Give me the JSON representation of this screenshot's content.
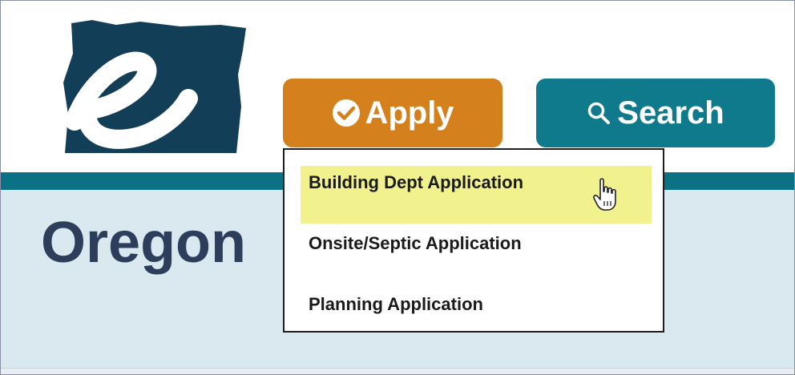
{
  "logo": {
    "icon": "eoregon-logo-icon",
    "brand_color": "#123f57"
  },
  "header": {
    "apply_label": "Apply",
    "apply_icon": "check-circle-icon",
    "apply_color": "#d4801c",
    "search_label": "Search",
    "search_icon": "search-icon",
    "search_color": "#0e7a8c"
  },
  "page": {
    "title": "Oregon"
  },
  "dropdown": {
    "highlighted_index": 0,
    "items": [
      {
        "label": "Building Dept Application"
      },
      {
        "label": "Onsite/Septic Application"
      },
      {
        "label": "Planning Application"
      }
    ]
  },
  "cursor": {
    "icon": "hand-pointer-icon"
  }
}
